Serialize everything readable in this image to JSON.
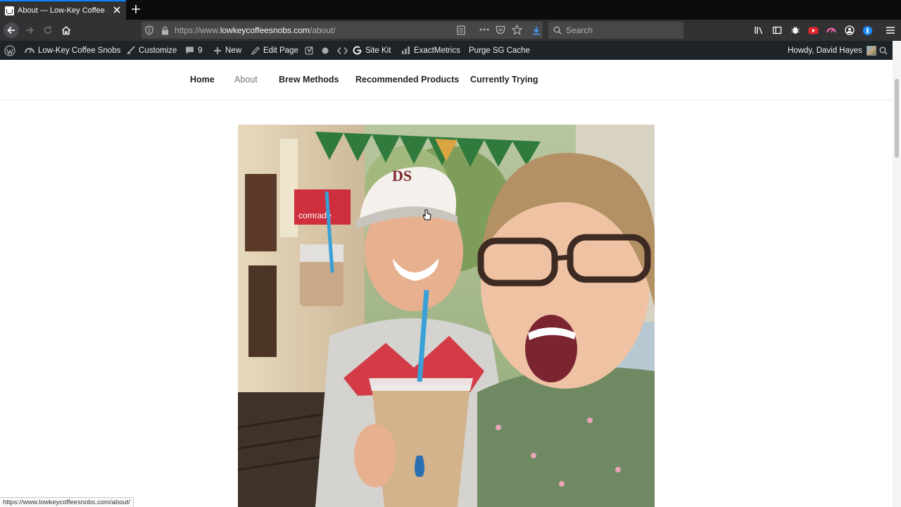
{
  "browser": {
    "tab_title": "About — Low-Key Coffee Snobs",
    "url_prefix": "https://www.",
    "url_domain": "lowkeycoffeesnobs.com",
    "url_path": "/about/",
    "search_placeholder": "Search",
    "accent_color": "#0a84ff"
  },
  "adminbar": {
    "site_name": "Low-Key Coffee Snobs",
    "customize": "Customize",
    "comments_count": "9",
    "new": "New",
    "edit_page": "Edit Page",
    "site_kit": "Site Kit",
    "exactmetrics": "ExactMetrics",
    "purge_cache": "Purge SG Cache",
    "howdy": "Howdy, David Hayes"
  },
  "site_nav": {
    "items": [
      "Home",
      "About",
      "Brew Methods",
      "Recommended Products",
      "Currently Trying"
    ],
    "current": "About"
  },
  "photo": {
    "cup_sign_text": "comrade",
    "cap_text": "DS"
  },
  "status": {
    "hover_url": "https://www.lowkeycoffeesnobs.com/about/"
  }
}
